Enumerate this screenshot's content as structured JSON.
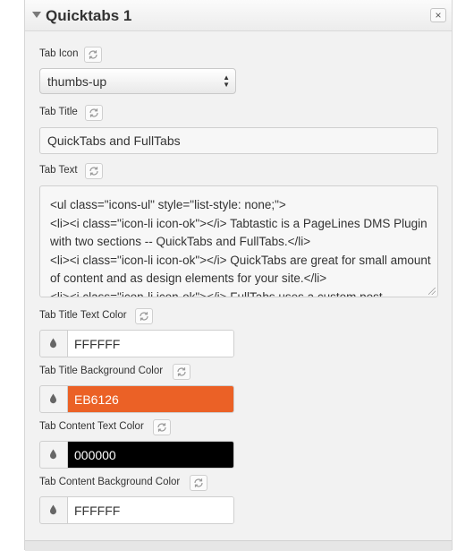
{
  "panel": {
    "title": "Quicktabs 1",
    "close_label": "×"
  },
  "fields": {
    "tab_icon": {
      "label": "Tab Icon",
      "value": "thumbs-up"
    },
    "tab_title": {
      "label": "Tab Title",
      "value": "QuickTabs and FullTabs"
    },
    "tab_text": {
      "label": "Tab Text",
      "value": "<ul class=\"icons-ul\" style=\"list-style: none;\">\n<li><i class=\"icon-li icon-ok\"></i> Tabtastic is a PageLines DMS Plugin with two sections -- QuickTabs and FullTabs.</li>\n<li><i class=\"icon-li icon-ok\"></i> QuickTabs are great for small amount of content and as design elements for your site.</li>\n<li><i class=\"icon-li icon-ok\"></i> FullTabs uses a custom post"
    },
    "title_text_color": {
      "label": "Tab Title Text Color",
      "value": "FFFFFF",
      "color": "#ffffff",
      "text_color": "#333333"
    },
    "title_bg_color": {
      "label": "Tab Title Background Color",
      "value": "EB6126",
      "color": "#eb6126",
      "text_color": "#ffffff"
    },
    "content_text_color": {
      "label": "Tab Content Text Color",
      "value": "000000",
      "color": "#000000",
      "text_color": "#ffffff"
    },
    "content_bg_color": {
      "label": "Tab Content Background Color",
      "value": "FFFFFF",
      "color": "#ffffff",
      "text_color": "#333333"
    }
  },
  "icons": {
    "collapse": "caret-down-icon",
    "close": "close-icon",
    "reset": "refresh-icon",
    "color": "drop-icon"
  }
}
